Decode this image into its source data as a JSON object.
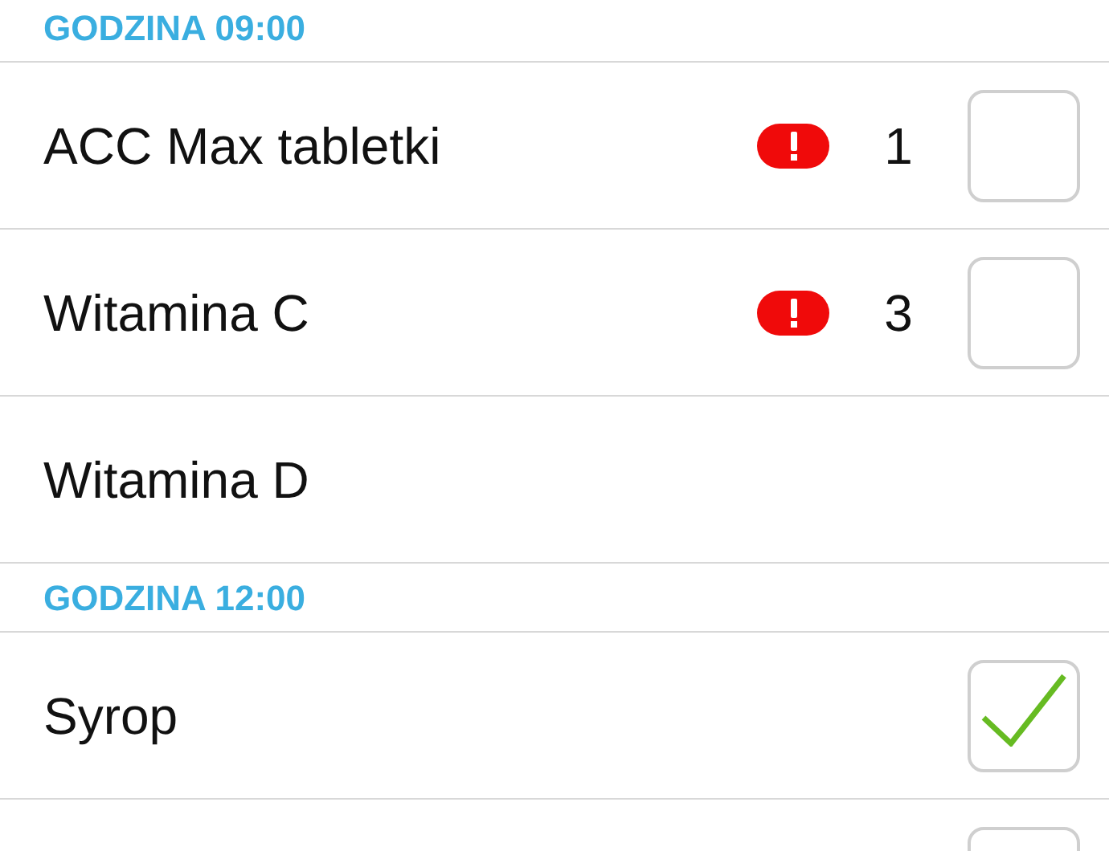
{
  "sections": [
    {
      "title": "GODZINA 09:00",
      "items": [
        {
          "name": "ACC Max tabletki",
          "kind": "check",
          "alert": true,
          "count": "1",
          "checked": false
        },
        {
          "name": "Witamina C",
          "kind": "check",
          "alert": true,
          "count": "3",
          "checked": false
        },
        {
          "name": "Witamina D",
          "kind": "plain"
        }
      ]
    },
    {
      "title": "GODZINA 12:00",
      "items": [
        {
          "name": "Syrop",
          "kind": "check",
          "alert": false,
          "checked": true
        },
        {
          "kind": "check",
          "alert": false,
          "checked": false
        }
      ]
    }
  ]
}
